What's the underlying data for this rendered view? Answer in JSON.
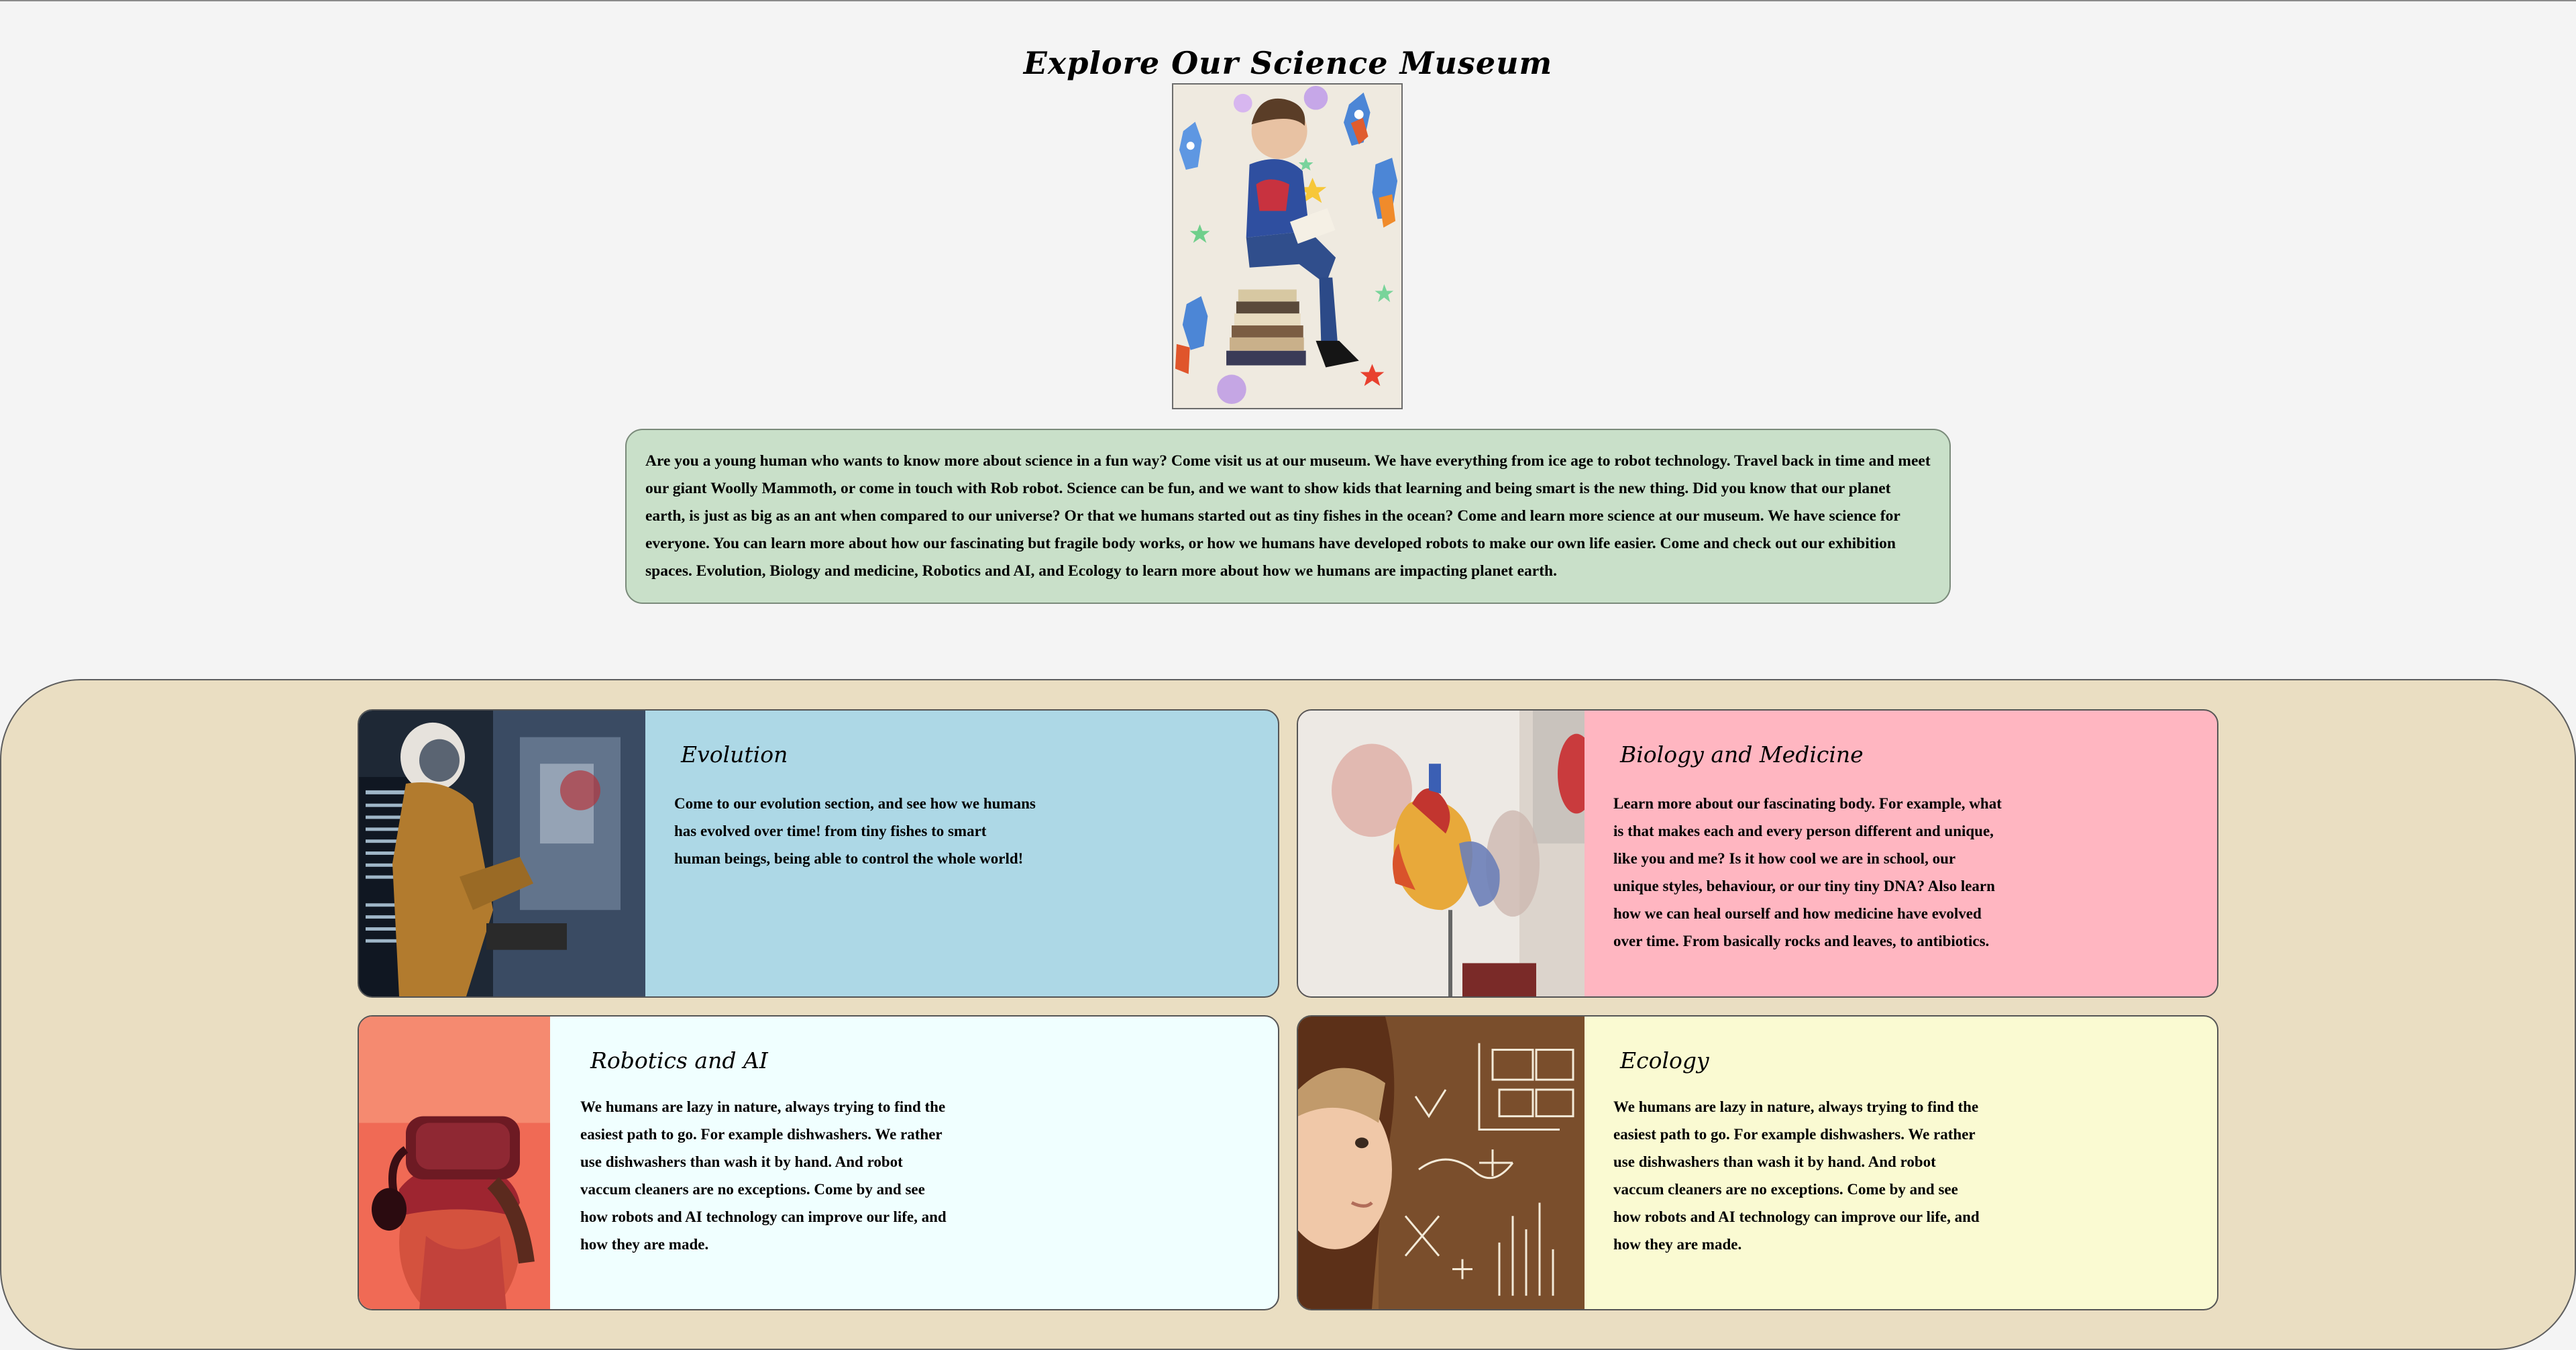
{
  "page": {
    "title": "Explore Our Science Museum",
    "hero_image": "child-reading-on-books-with-rockets-image",
    "intro_text": "Are you a young human who wants to know more about science in a fun way? Come visit us at our museum. We have everything from ice age to robot technology. Travel back in time and meet our giant Woolly Mammoth, or come in touch with Rob robot. Science can be fun, and we want to show kids that learning and being smart is the new thing. Did you know that our planet earth, is just as big as an ant when compared to our universe? Or that we humans started out as tiny fishes in the ocean? Come and learn more science at our museum. We have science for everyone. You can learn more about how our fascinating but fragile body works, or how we humans have developed robots to make our own life easier. Come and check out our exhibition spaces. Evolution, Biology and medicine, Robotics and AI, and Ecology to learn more about how we humans are impacting planet earth."
  },
  "exhibits": [
    {
      "title": "Evolution",
      "text": "Come to our evolution section, and see how we humans has evolved over time! from tiny fishes to smart human beings, being able to control the whole world!",
      "image": "astronaut-in-cockpit-image",
      "color": "#add8e6"
    },
    {
      "title": "Biology and Medicine",
      "text": "Learn more about our fascinating body. For example, what is that makes each and every person different and unique, like you and me? Is it how cool we are in school, our unique styles, behaviour, or our tiny tiny DNA? Also learn how we can heal ourself and how medicine have evolved over time. From basically rocks and leaves, to antibiotics.",
      "image": "anatomical-heart-model-image",
      "color": "#ffb6c1"
    },
    {
      "title": "Robotics and AI",
      "text": "We humans are lazy in nature, always trying to find the easiest path to go. For example dishwashers. We rather use dishwashers than wash it by hand. And robot vaccum cleaners are no exceptions. Come by and see how robots and AI technology can improve our life, and how they are made.",
      "image": "child-with-vr-headset-image",
      "color": "#f0ffff"
    },
    {
      "title": "Ecology",
      "text": "We humans are lazy in nature, always trying to find the easiest path to go. For example dishwashers. We rather use dishwashers than wash it by hand. And robot vaccum cleaners are no exceptions. Come by and see how robots and AI technology can improve our life, and how they are made.",
      "image": "child-at-chalkboard-formulas-image",
      "color": "#fafad2"
    }
  ],
  "colors": {
    "page_background": "#f4f4f4",
    "intro_background": "#c9e0c9",
    "panel_background": "#eadec2"
  }
}
